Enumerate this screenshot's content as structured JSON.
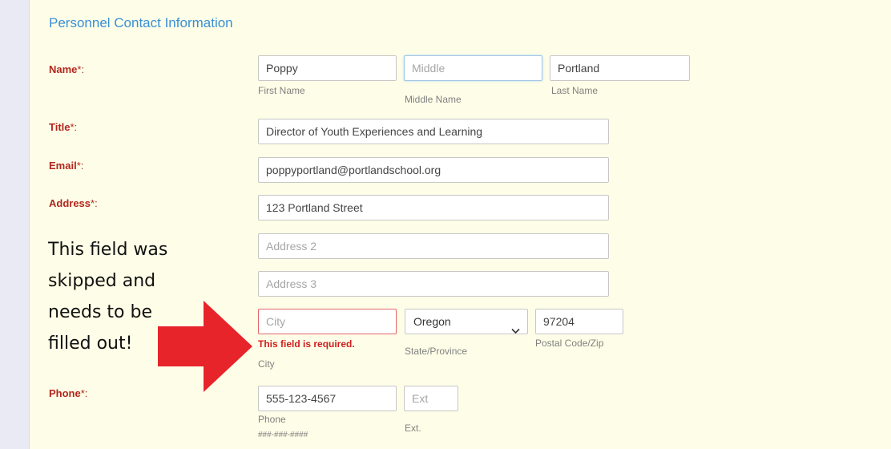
{
  "section": {
    "title": "Personnel Contact Information"
  },
  "labels": {
    "name": "Name",
    "title": "Title",
    "email": "Email",
    "address": "Address",
    "phone": "Phone",
    "required_mark": "*:"
  },
  "name": {
    "first_value": "Poppy",
    "middle_placeholder": "Middle",
    "last_value": "Portland",
    "first_caption": "First Name",
    "middle_caption": "Middle Name",
    "last_caption": "Last Name"
  },
  "title_field": {
    "value": "Director of Youth Experiences and Learning"
  },
  "email_field": {
    "value": "poppyportland@portlandschool.org"
  },
  "address": {
    "line1_value": "123 Portland Street",
    "line2_placeholder": "Address 2",
    "line3_placeholder": "Address 3",
    "city_placeholder": "City",
    "city_error": "This field is required.",
    "city_caption": "City",
    "state_value": "Oregon",
    "state_caption": "State/Province",
    "zip_value": "97204",
    "zip_caption": "Postal Code/Zip"
  },
  "phone": {
    "value": "555-123-4567",
    "ext_placeholder": "Ext",
    "phone_caption": "Phone",
    "phone_format": "###-###-####",
    "ext_caption": "Ext."
  },
  "annotation": {
    "lines": [
      "This field was",
      "skipped and",
      "needs to be",
      "filled out!"
    ],
    "arrow_color": "#e8242b",
    "icon": "right-arrow-icon"
  },
  "colors": {
    "label": "#b3261e",
    "title": "#3a8fd6",
    "error": "#d01d1d",
    "background": "#fefee8"
  }
}
